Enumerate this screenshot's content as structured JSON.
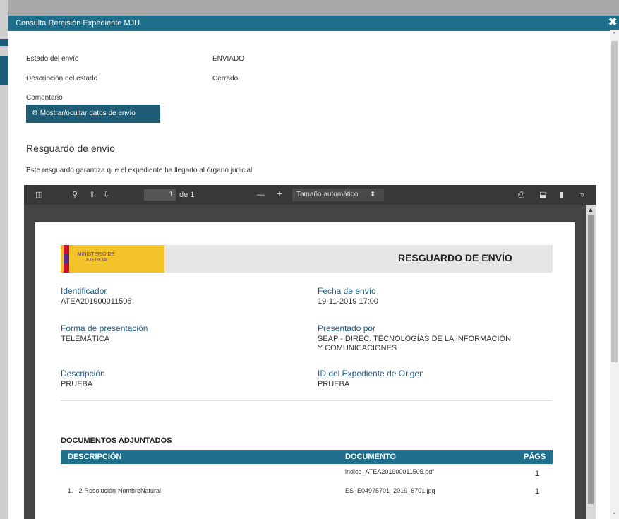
{
  "modal": {
    "title": "Consulta Remisión Expediente MJU",
    "close_glyph": "✖"
  },
  "fields": [
    {
      "label": "Estado del envío",
      "value": "ENVIADO"
    },
    {
      "label": "Descripción del estado",
      "value": "Cerrado"
    },
    {
      "label": "Comentario",
      "value": ""
    }
  ],
  "toggle_button": {
    "icon": "gear-icon",
    "label": "Mostrar/ocultar datos de envío"
  },
  "section": {
    "title": "Resguardo de envío",
    "note": "Este resguardo garantiza que el expediente ha llegado al órgano judicial."
  },
  "viewer": {
    "page_current": "1",
    "page_total": "de 1",
    "zoom": "Tamaño automático",
    "glyphs": {
      "sidebar": "◫",
      "search": "⚲",
      "prev": "⇧",
      "next": "⇩",
      "zoom_out": "—",
      "zoom_in": "+",
      "print": "⎙",
      "download": "⬓",
      "bookmark": "▮",
      "more": "»",
      "dropdown": "⬍"
    }
  },
  "document": {
    "logo_text": "MINISTERIO DE JUSTICIA",
    "title": "RESGUARDO DE ENVÍO",
    "identificador_label": "Identificador",
    "identificador_value": "ATEA201900011505",
    "fecha_label": "Fecha de envío",
    "fecha_value": "19-11-2019 17:00",
    "forma_label": "Forma de presentación",
    "forma_value": "TELEMÁTICA",
    "presentado_label": "Presentado por",
    "presentado_value_1": "SEAP - DIREC. TECNOLOGÍAS DE LA INFORMACIÓN",
    "presentado_value_2": "Y COMUNICACIONES",
    "descripcion_label": "Descripción",
    "descripcion_value": "PRUEBA",
    "idexp_label": "ID del Expediente de Origen",
    "idexp_value": "PRUEBA",
    "docs_title": "DOCUMENTOS ADJUNTADOS",
    "table_headers": [
      "DESCRIPCIÓN",
      "DOCUMENTO",
      "PÁGS"
    ],
    "rows": [
      {
        "descripcion": "",
        "documento": "indice_ATEA201900011505.pdf",
        "pags": "1"
      },
      {
        "descripcion": "1. - 2-Resolución-NombreNatural",
        "documento": "ES_E04975701_2019_6701.jpg",
        "pags": "1"
      }
    ]
  },
  "colors": {
    "modal_header": "#1e6e8c",
    "button": "#1e5d75",
    "label_blue": "#1e5d8a",
    "viewer_toolbar": "#383838"
  }
}
